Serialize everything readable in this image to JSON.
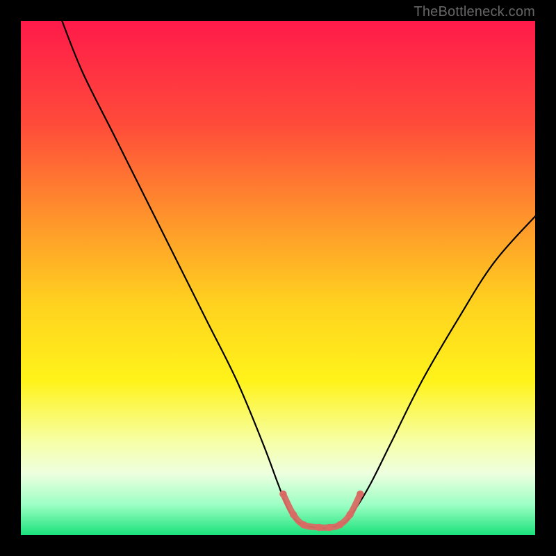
{
  "watermark": "TheBottleneck.com",
  "chart_data": {
    "type": "line",
    "title": "",
    "xlabel": "",
    "ylabel": "",
    "xlim": [
      0,
      100
    ],
    "ylim": [
      0,
      100
    ],
    "background_gradient": {
      "stops": [
        {
          "offset": 0,
          "color": "#ff1a4a"
        },
        {
          "offset": 20,
          "color": "#ff4b3a"
        },
        {
          "offset": 40,
          "color": "#ff9a2a"
        },
        {
          "offset": 55,
          "color": "#ffd21f"
        },
        {
          "offset": 70,
          "color": "#fff31a"
        },
        {
          "offset": 82,
          "color": "#f6ffa8"
        },
        {
          "offset": 88,
          "color": "#eeffe0"
        },
        {
          "offset": 94,
          "color": "#9effc5"
        },
        {
          "offset": 100,
          "color": "#1ae27a"
        }
      ]
    },
    "series": [
      {
        "name": "curve",
        "color": "#000000",
        "points": [
          {
            "x": 8,
            "y": 100
          },
          {
            "x": 12,
            "y": 90
          },
          {
            "x": 18,
            "y": 78
          },
          {
            "x": 24,
            "y": 66
          },
          {
            "x": 30,
            "y": 54
          },
          {
            "x": 36,
            "y": 42
          },
          {
            "x": 42,
            "y": 30
          },
          {
            "x": 47,
            "y": 18
          },
          {
            "x": 50,
            "y": 10
          },
          {
            "x": 52,
            "y": 5
          },
          {
            "x": 54,
            "y": 2.5
          },
          {
            "x": 57,
            "y": 1.5
          },
          {
            "x": 60,
            "y": 1.5
          },
          {
            "x": 63,
            "y": 2.5
          },
          {
            "x": 65,
            "y": 5
          },
          {
            "x": 68,
            "y": 10
          },
          {
            "x": 72,
            "y": 18
          },
          {
            "x": 78,
            "y": 30
          },
          {
            "x": 85,
            "y": 42
          },
          {
            "x": 92,
            "y": 53
          },
          {
            "x": 100,
            "y": 62
          }
        ]
      },
      {
        "name": "highlight",
        "color": "#d86b63",
        "points": [
          {
            "x": 51,
            "y": 8
          },
          {
            "x": 53,
            "y": 4
          },
          {
            "x": 55,
            "y": 2
          },
          {
            "x": 58,
            "y": 1.5
          },
          {
            "x": 60,
            "y": 1.5
          },
          {
            "x": 62,
            "y": 2
          },
          {
            "x": 64,
            "y": 4
          },
          {
            "x": 66,
            "y": 8
          }
        ]
      }
    ]
  }
}
